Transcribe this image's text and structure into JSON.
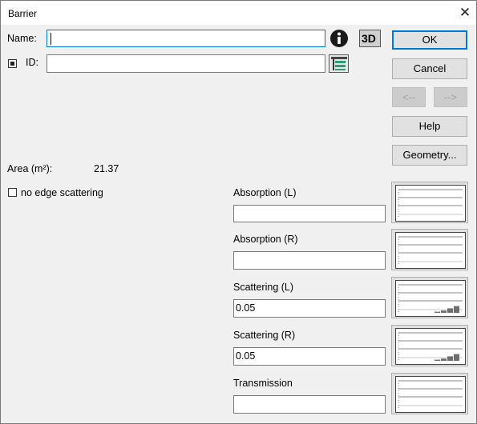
{
  "window": {
    "title": "Barrier",
    "close_glyph": "✕"
  },
  "form": {
    "name_label": "Name:",
    "name_value": "",
    "id_label": "ID:",
    "id_value": "",
    "id_checked": true,
    "three_d_label": "3D"
  },
  "buttons": {
    "ok": "OK",
    "cancel": "Cancel",
    "prev": "<--",
    "next": "-->",
    "help": "Help",
    "geometry": "Geometry..."
  },
  "area": {
    "label": "Area (m²):",
    "value": "21.37"
  },
  "edge_scattering": {
    "label": "no edge scattering",
    "checked": false
  },
  "properties": [
    {
      "label": "Absorption (L)",
      "value": "",
      "graph": []
    },
    {
      "label": "Absorption (R)",
      "value": "",
      "graph": []
    },
    {
      "label": "Scattering (L)",
      "value": "0.05",
      "graph": [
        0.05,
        0.1,
        0.2,
        0.3
      ]
    },
    {
      "label": "Scattering (R)",
      "value": "0.05",
      "graph": [
        0.05,
        0.1,
        0.2,
        0.3
      ]
    },
    {
      "label": "Transmission",
      "value": "",
      "graph": []
    }
  ],
  "icons": {
    "info": "info-icon",
    "three_d": "3d-view-icon",
    "id_list": "id-list-icon",
    "close": "close-icon"
  },
  "colors": {
    "accent": "#0078d7",
    "dialog_bg": "#f0f0f0"
  }
}
